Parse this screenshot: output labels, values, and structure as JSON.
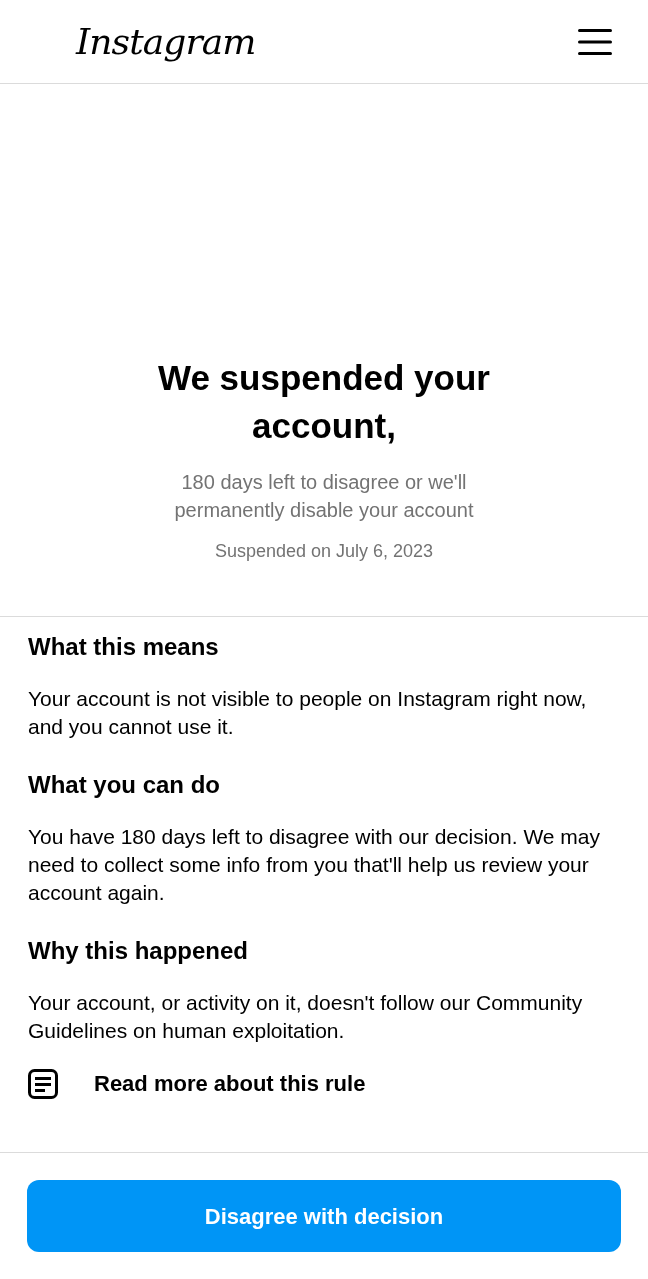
{
  "header": {
    "logo": "Instagram"
  },
  "notice": {
    "title": "We suspended your account,",
    "subtitle": "180 days left to disagree or we'll permanently disable your account",
    "date": "Suspended on July 6, 2023"
  },
  "sections": [
    {
      "heading": "What this means",
      "body": "Your account is not visible to people on Instagram right now, and you cannot use it."
    },
    {
      "heading": "What you can do",
      "body": "You have 180 days left to disagree with our decision. We may need to collect some info from you that'll help us review your account again."
    },
    {
      "heading": "Why this happened",
      "body": "Your account, or activity on it, doesn't follow our Community Guidelines on human exploitation."
    }
  ],
  "rule_link": {
    "label": "Read more about this rule"
  },
  "primary_button": {
    "label": "Disagree with decision"
  }
}
